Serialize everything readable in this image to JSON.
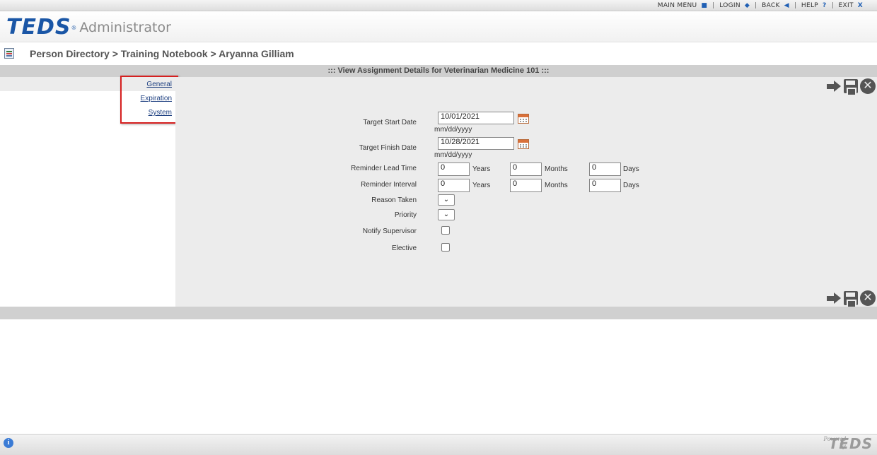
{
  "topnav": {
    "main_menu": "MAIN MENU",
    "login": "LOGIN",
    "back": "BACK",
    "help": "HELP",
    "exit": "EXIT"
  },
  "header": {
    "logo_text": "TEDS",
    "app_name": "Administrator"
  },
  "breadcrumb": "Person Directory > Training Notebook > Aryanna Gilliam",
  "title": "::: View Assignment Details for Veterinarian Medicine 101 :::",
  "leftnav": {
    "items": [
      {
        "label": "General"
      },
      {
        "label": "Expiration"
      },
      {
        "label": "System"
      }
    ]
  },
  "form": {
    "target_start_date": {
      "label": "Target Start Date",
      "value": "10/01/2021",
      "hint": "mm/dd/yyyy"
    },
    "target_finish_date": {
      "label": "Target Finish Date",
      "value": "10/28/2021",
      "hint": "mm/dd/yyyy"
    },
    "reminder_lead_time": {
      "label": "Reminder Lead Time",
      "years": "0",
      "months": "0",
      "days": "0"
    },
    "reminder_interval": {
      "label": "Reminder Interval",
      "years": "0",
      "months": "0",
      "days": "0"
    },
    "units": {
      "years": "Years",
      "months": "Months",
      "days": "Days"
    },
    "reason_taken": {
      "label": "Reason Taken"
    },
    "priority": {
      "label": "Priority"
    },
    "notify_supervisor": {
      "label": "Notify Supervisor",
      "checked": false
    },
    "elective": {
      "label": "Elective",
      "checked": false
    }
  },
  "footer": {
    "powered_by_1": "Powered",
    "powered_by_2": "By",
    "powered_logo": "TEDS"
  },
  "icons": {
    "main_menu": "square-icon",
    "login": "diamond-icon",
    "back": "triangle-left-icon",
    "help": "question-icon",
    "exit": "x-icon"
  },
  "colors": {
    "brand_blue": "#1a56a6",
    "highlight_red": "#d62020",
    "link": "#1d3f80",
    "panel_gray": "#ececec"
  }
}
